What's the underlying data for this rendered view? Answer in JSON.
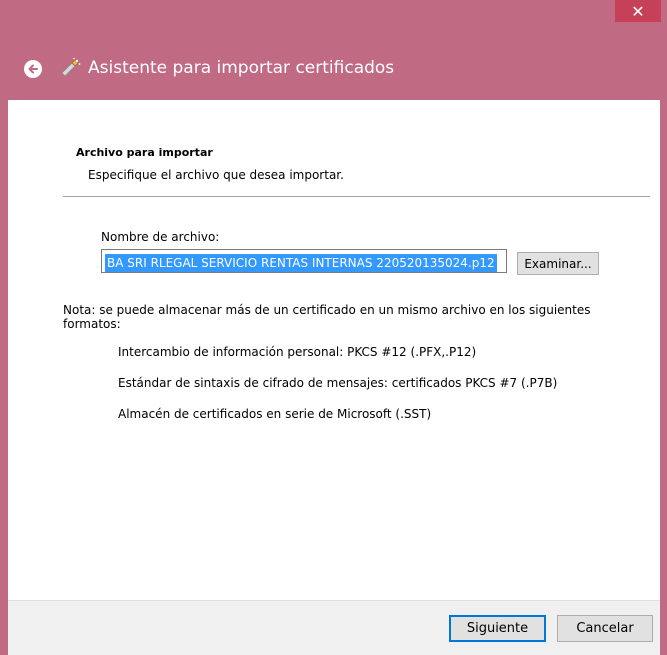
{
  "window": {
    "title": "Asistente para importar certificados",
    "close_glyph": "✕"
  },
  "section": {
    "title": "Archivo para importar",
    "description": "Especifique el archivo que desea importar."
  },
  "file": {
    "label": "Nombre de archivo:",
    "value": "BA SRI RLEGAL SERVICIO RENTAS INTERNAS 220520135024.p12",
    "browse_label": "Examinar..."
  },
  "note": "Nota: se puede almacenar más de un certificado en un mismo archivo en los siguientes formatos:",
  "formats": [
    "Intercambio de información personal: PKCS #12 (.PFX,.P12)",
    "Estándar de sintaxis de cifrado de mensajes: certificados PKCS #7 (.P7B)",
    "Almacén de certificados en serie de Microsoft (.SST)"
  ],
  "buttons": {
    "next": "Siguiente",
    "cancel": "Cancelar"
  },
  "colors": {
    "titlebar": "#c06a83",
    "close": "#c7405a",
    "selection": "#3399ff",
    "default_button_border": "#0078d7"
  },
  "icons": {
    "back": "back-arrow-icon",
    "wizard": "certificate-wizard-icon",
    "close": "close-icon"
  }
}
